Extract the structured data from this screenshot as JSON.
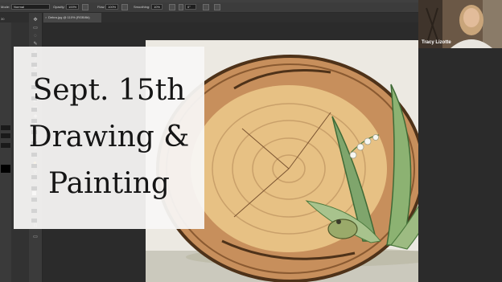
{
  "options_bar": {
    "mode_label": "Mode:",
    "mode_value": "Normal",
    "opacity_label": "Opacity:",
    "opacity_value": "100%",
    "flow_label": "Flow:",
    "flow_value": "100%",
    "smoothing_label": "Smoothing:",
    "smoothing_value": "10%",
    "angle_value": "0°"
  },
  "left_dock": {
    "number": "30"
  },
  "document_tab": {
    "title": "Debra.jpg @ 110% (RGB/8#)",
    "close": "×"
  },
  "overlay": {
    "line1": "Sept. 15th",
    "line2": "Drawing &",
    "line3": "Painting"
  },
  "webcam": {
    "name": "Tracy Lizotte"
  },
  "colors": {
    "panel": "#323232",
    "canvas_bg": "#ece9e2",
    "wood_light": "#e9c79a",
    "wood_dark": "#6e4a2a",
    "leaf_green": "#7fa56c"
  },
  "icons": {
    "toolbar": [
      "move-icon",
      "marquee-icon",
      "lasso-icon",
      "quick-select-icon",
      "crop-icon",
      "eyedropper-icon",
      "healing-icon",
      "brush-icon",
      "clone-stamp-icon",
      "history-brush-icon",
      "eraser-icon",
      "gradient-icon",
      "blur-icon",
      "dodge-icon",
      "pen-icon",
      "type-icon",
      "path-select-icon",
      "shape-icon",
      "hand-icon",
      "zoom-icon",
      "more-tools-icon",
      "color-swatch-icon",
      "quick-mask-icon",
      "screen-mode-icon"
    ]
  }
}
